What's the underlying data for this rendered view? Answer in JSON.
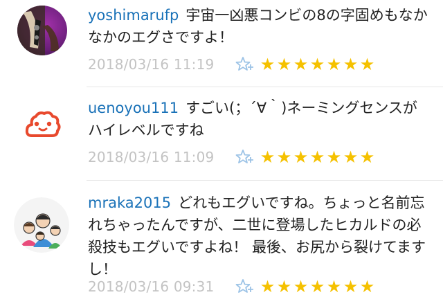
{
  "comments": [
    {
      "username": "yoshimarufp",
      "text": "宇宙一凶悪コンビの8の字固めもなかなかのエグさですよ！",
      "timestamp": "2018/03/16 11:19",
      "star_count": 7
    },
    {
      "username": "uenoyou111",
      "text": "すごい(；´∀｀)ネーミングセンスがハイレベルですね",
      "timestamp": "2018/03/16 11:09",
      "star_count": 7
    },
    {
      "username": "mraka2015",
      "text": "どれもエグいですね。ちょっと名前忘れちゃったんですが、二世に登場したヒカルドの必殺技もエグいですよね！ 最後、お尻から裂けてますし！",
      "timestamp": "2018/03/16 09:31",
      "star_count": 7
    }
  ],
  "icons": {
    "add_star": "add-star-icon",
    "star": "★"
  },
  "colors": {
    "username": "#1a72b8",
    "timestamp": "#c3c3c3",
    "star": "#f5c100",
    "add_star": "#9cc3e6",
    "uenoyou_avatar": "#e8492d"
  }
}
